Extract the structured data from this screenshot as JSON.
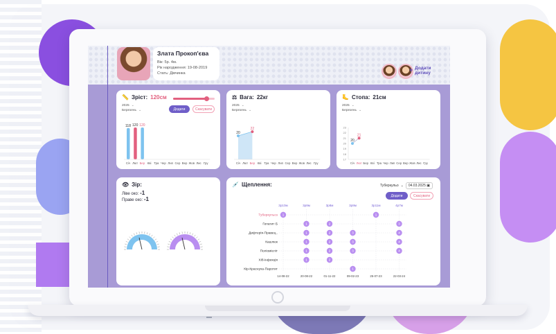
{
  "profile": {
    "name": "Злата Прокоп'єва",
    "age_line": "Вік: 5р. 4м.",
    "birth_line": "Рік народження: 19-08-2019",
    "gender_line": "Стать: Дівчинка"
  },
  "header": {
    "add_child_label_1": "Додати",
    "add_child_label_2": "дитину",
    "add_child_plus": "+"
  },
  "height_card": {
    "icon": "ruler-icon",
    "label": "Зріст:",
    "value": "120см",
    "year": "2025",
    "month": "Березень",
    "add_label": "Додати",
    "cancel_label": "Скасувати",
    "slider_fraction": 0.8
  },
  "weight_card": {
    "icon": "scale-icon",
    "label": "Вага:",
    "value": "22кг",
    "year": "2025",
    "month": "Березень"
  },
  "foot_card": {
    "icon": "foot-icon",
    "label": "Стопа:",
    "value": "21см",
    "year": "2025",
    "month": "Березень"
  },
  "vision_card": {
    "icon": "eye-icon",
    "label": "Зір:",
    "left_label": "Ліве око:",
    "left_value": "-1",
    "right_label": "Праве око:",
    "right_value": "-1"
  },
  "vaccine_card": {
    "icon": "syringe-icon",
    "label": "Щеплення:",
    "filter_label": "Туберкульо",
    "date": "04.03.2025",
    "add_label": "Додати",
    "cancel_label": "Скасувати"
  },
  "chart_data": [
    {
      "type": "bar",
      "title": "Зріст",
      "categories": [
        "Січ",
        "Лют",
        "Бер",
        "Кві",
        "Тра",
        "Чер",
        "Лип",
        "Сер",
        "Вер",
        "Жов",
        "Лис",
        "Гру"
      ],
      "highlight_category": "Бер",
      "values": [
        118,
        120,
        120,
        null,
        null,
        null,
        null,
        null,
        null,
        null,
        null,
        null
      ],
      "data_labels": [
        "118",
        "120",
        "120"
      ],
      "colors": [
        "#7ec3ef",
        "#e2607f",
        "#7ec3ef"
      ]
    },
    {
      "type": "area",
      "title": "Вага",
      "categories": [
        "Січ",
        "Лют",
        "Бер",
        "Кві",
        "Тра",
        "Чер",
        "Лип",
        "Сер",
        "Вер",
        "Жов",
        "Лис",
        "Гру"
      ],
      "highlight_category": "Бер",
      "values": [
        20,
        null,
        22,
        null,
        null,
        null,
        null,
        null,
        null,
        null,
        null,
        null
      ],
      "data_labels": [
        "20",
        "22"
      ]
    },
    {
      "type": "line",
      "title": "Стопа",
      "categories": [
        "Січ",
        "Лют",
        "Бер",
        "Кві",
        "Тра",
        "Чер",
        "Лип",
        "Сер",
        "Вер",
        "Жов",
        "Лис",
        "Гру"
      ],
      "highlight_category": "Лют",
      "values": [
        20,
        21,
        null,
        null,
        null,
        null,
        null,
        null,
        null,
        null,
        null,
        null
      ],
      "data_labels": [
        "20",
        "21"
      ],
      "y_ticks": [
        "23",
        "22",
        "21",
        "20",
        "19",
        "18",
        "17"
      ],
      "ylim": [
        17,
        23
      ]
    },
    {
      "type": "scatter",
      "title": "Щеплення",
      "vaccines": [
        "Туберкульоз",
        "Гепатит Б",
        "Дифтерія-Правец..",
        "Кашлюк",
        "Поліомієліт",
        "Хіб-інфекція",
        "Кір-Краснуха-Паротит"
      ],
      "highlight_vaccine": "Туберкульоз",
      "age_labels": [
        "3р10м",
        "3р8м",
        "3р8м",
        "3р8м",
        "3р11м",
        "4р7м"
      ],
      "date_labels": [
        "14-08-22",
        "20-08-22",
        "01-11-22",
        "09-02-23",
        "25-07-23",
        "22-03-24"
      ],
      "points": [
        {
          "vaccine": "Туберкульоз",
          "col": 0,
          "dose": "1"
        },
        {
          "vaccine": "Туберкульоз",
          "col": 4,
          "dose": "1"
        },
        {
          "vaccine": "Гепатит Б",
          "col": 1,
          "dose": "1"
        },
        {
          "vaccine": "Гепатит Б",
          "col": 2,
          "dose": "2"
        },
        {
          "vaccine": "Гепатит Б",
          "col": 5,
          "dose": "3"
        },
        {
          "vaccine": "Дифтерія-Правец..",
          "col": 1,
          "dose": "1"
        },
        {
          "vaccine": "Дифтерія-Правец..",
          "col": 2,
          "dose": "2"
        },
        {
          "vaccine": "Дифтерія-Правец..",
          "col": 3,
          "dose": "3"
        },
        {
          "vaccine": "Дифтерія-Правец..",
          "col": 5,
          "dose": "4"
        },
        {
          "vaccine": "Кашлюк",
          "col": 1,
          "dose": "1"
        },
        {
          "vaccine": "Кашлюк",
          "col": 2,
          "dose": "2"
        },
        {
          "vaccine": "Кашлюк",
          "col": 3,
          "dose": "3"
        },
        {
          "vaccine": "Кашлюк",
          "col": 5,
          "dose": "4"
        },
        {
          "vaccine": "Поліомієліт",
          "col": 1,
          "dose": "1"
        },
        {
          "vaccine": "Поліомієліт",
          "col": 2,
          "dose": "2"
        },
        {
          "vaccine": "Поліомієліт",
          "col": 3,
          "dose": "3"
        },
        {
          "vaccine": "Поліомієліт",
          "col": 5,
          "dose": "4"
        },
        {
          "vaccine": "Хіб-інфекція",
          "col": 1,
          "dose": "1"
        },
        {
          "vaccine": "Хіб-інфекція",
          "col": 2,
          "dose": "2"
        },
        {
          "vaccine": "Кір-Краснуха-Паротит",
          "col": 3,
          "dose": "1"
        }
      ]
    }
  ],
  "colors": {
    "accent": "#e2607f",
    "primary": "#6f5ec8",
    "screen_bg": "#a89bd6",
    "bar_blue": "#7ec3ef",
    "dot_purple": "#b98ef0"
  }
}
